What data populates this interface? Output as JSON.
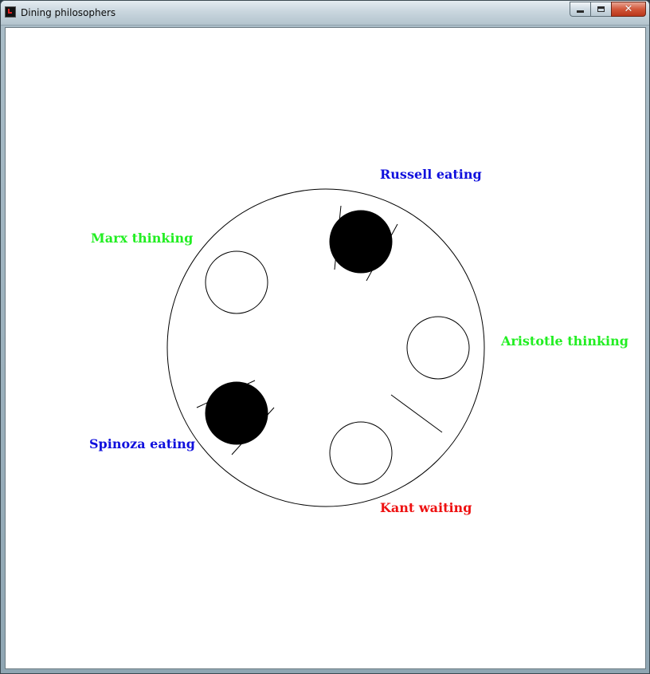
{
  "window": {
    "title": "Dining philosophers",
    "icon": "java-app-icon",
    "buttons": {
      "minimize": "minimize-icon",
      "maximize": "maximize-icon",
      "close": "close-icon"
    }
  },
  "colors": {
    "thinking": "#22ee22",
    "eating": "#1010dd",
    "waiting": "#ee1111",
    "plate_eating": "#000000",
    "plate_idle": "#ffffff",
    "stroke": "#000000"
  },
  "philosophers": [
    {
      "name": "Russell",
      "state": "eating",
      "label": "Russell eating"
    },
    {
      "name": "Aristotle",
      "state": "thinking",
      "label": "Aristotle thinking"
    },
    {
      "name": "Kant",
      "state": "waiting",
      "label": "Kant waiting"
    },
    {
      "name": "Spinoza",
      "state": "eating",
      "label": "Spinoza eating"
    },
    {
      "name": "Marx",
      "state": "thinking",
      "label": "Marx thinking"
    }
  ],
  "chopsticks": [
    {
      "between": [
        "Russell",
        "Marx"
      ],
      "held_by": "Russell"
    },
    {
      "between": [
        "Russell",
        "Aristotle"
      ],
      "held_by": "Russell"
    },
    {
      "between": [
        "Aristotle",
        "Kant"
      ],
      "held_by": null
    },
    {
      "between": [
        "Kant",
        "Spinoza"
      ],
      "held_by": "Spinoza"
    },
    {
      "between": [
        "Spinoza",
        "Marx"
      ],
      "held_by": "Spinoza"
    }
  ]
}
